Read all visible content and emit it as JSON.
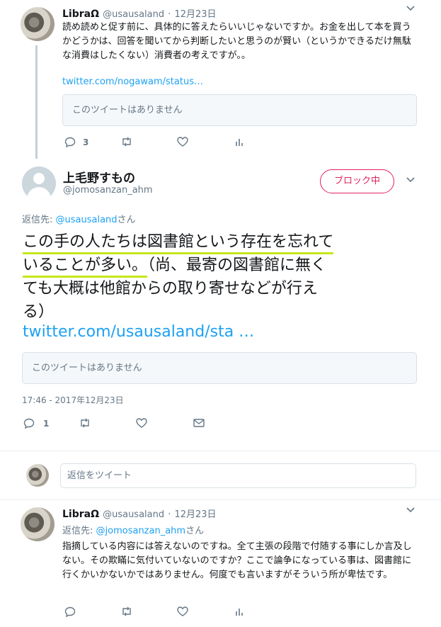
{
  "tweets": [
    {
      "name": "LibraΩ",
      "handle": "@usausaland",
      "separator": "·",
      "date": "12月23日",
      "text": "読め読めと促す前に、具体的に答えたらいいじゃないですか。お金を出して本を買うかどうかは、回答を聞いてから判断したいと思うのが賢い（というかできるだけ無駄な消費はしたくない）消費者の考えですが。。",
      "link": "twitter.com/nogawam/status…",
      "quote": "このツイートはありません",
      "replies": "3"
    },
    {
      "name": "上毛野すもの",
      "handle": "@jomosanzan_ahm",
      "block_label": "ブロック中",
      "reply_to_prefix": "返信先: ",
      "reply_to_handle": "@usausaland",
      "reply_to_suffix": "さん",
      "text_line1": "この手の人たちは図書館という存在を忘れて",
      "text_line2a": "いることが多い。",
      "text_line2b": "（尚、最寄の図書館に無く",
      "text_line3": "ても大概は他館からの取り寄せなどが行え",
      "text_line4": "る）",
      "link": "twitter.com/usausaland/sta …",
      "quote": "このツイートはありません",
      "timestamp": "17:46 - 2017年12月23日",
      "replies": "1"
    },
    {
      "name": "LibraΩ",
      "handle": "@usausaland",
      "separator": "·",
      "date": "12月23日",
      "reply_to_prefix": "返信先: ",
      "reply_to_handle": "@jomosanzan_ahm",
      "reply_to_suffix": "さん",
      "text": "指摘している内容には答えないのですね。全て主張の段階で付随する事にしか言及しない。その欺瞞に気付いていないのですか？ここで論争になっている事は、図書館に行くかいかないかではありません。何度でも言いますがそういう所が卑怯です。"
    }
  ],
  "compose": {
    "placeholder": "返信をツイート"
  },
  "colors": {
    "accent": "#1da1f2",
    "block": "#e0245e",
    "highlight": "#c7e61a",
    "muted": "#657786"
  },
  "icons": [
    "chevron-down-icon",
    "reply-icon",
    "retweet-icon",
    "like-icon",
    "analytics-icon",
    "dm-icon"
  ]
}
